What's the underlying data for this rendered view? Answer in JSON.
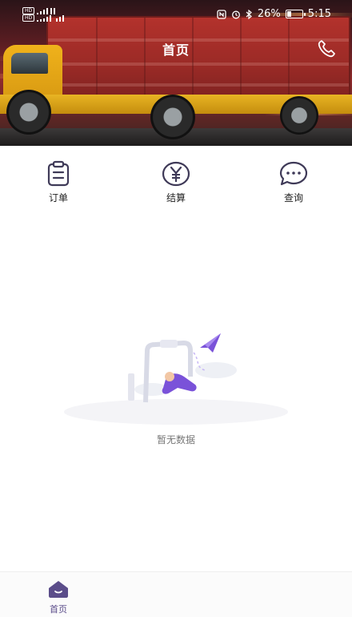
{
  "status_bar": {
    "battery": "26%",
    "time": "5:15",
    "battery_level": 0.26,
    "sim1": "HD",
    "sim2": "HD"
  },
  "header": {
    "title": "首页"
  },
  "menu": {
    "items": [
      {
        "label": "订单",
        "icon": "order-clipboard-icon"
      },
      {
        "label": "结算",
        "icon": "yuan-settlement-icon"
      },
      {
        "label": "查询",
        "icon": "chat-query-icon"
      }
    ]
  },
  "empty_state": {
    "message": "暂无数据"
  },
  "bottom_nav": {
    "items": [
      {
        "label": "首页",
        "icon": "home-icon",
        "active": true
      }
    ]
  },
  "colors": {
    "accent": "#5b4d8a",
    "icon_stroke": "#3f3a58",
    "illustration_purple": "#7a52d9"
  }
}
